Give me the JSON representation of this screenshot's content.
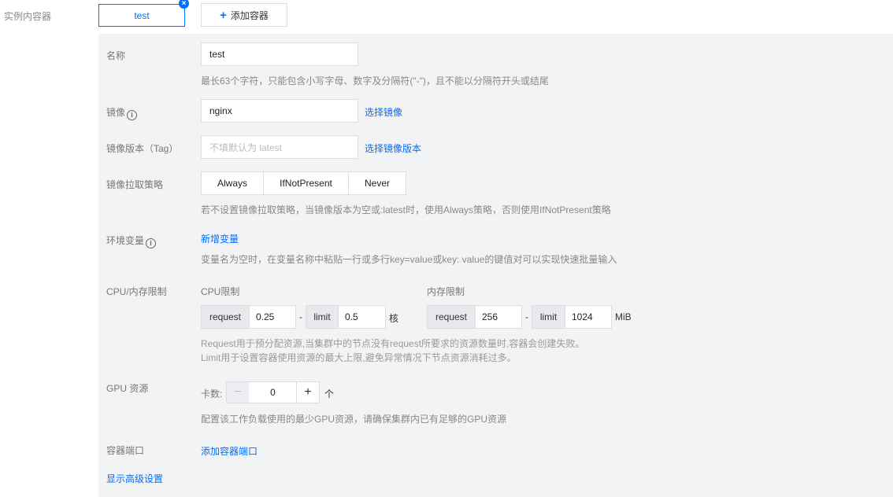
{
  "sidebar": {
    "label": "实例内容器"
  },
  "tabs": {
    "current": "test",
    "close_icon": "×",
    "add_container_label": "添加容器",
    "add_icon": "+"
  },
  "form": {
    "name": {
      "label": "名称",
      "value": "test",
      "hint": "最长63个字符，只能包含小写字母、数字及分隔符(\"-\")，且不能以分隔符开头或结尾"
    },
    "image": {
      "label": "镜像",
      "info_icon": "i",
      "value": "nginx",
      "select_link": "选择镜像"
    },
    "image_tag": {
      "label": "镜像版本（Tag）",
      "placeholder": "不填默认为 latest",
      "select_link": "选择镜像版本"
    },
    "pull_policy": {
      "label": "镜像拉取策略",
      "options": [
        "Always",
        "IfNotPresent",
        "Never"
      ],
      "hint": "若不设置镜像拉取策略，当镜像版本为空或:latest时，使用Always策略，否则使用IfNotPresent策略"
    },
    "env": {
      "label": "环境变量",
      "info_icon": "i",
      "add_link": "新增变量",
      "hint": "变量名为空时，在变量名称中粘贴一行或多行key=value或key: value的键值对可以实现快速批量输入"
    },
    "resources": {
      "label": "CPU/内存限制",
      "cpu": {
        "title": "CPU限制",
        "request_label": "request",
        "request_value": "0.25",
        "separator": "-",
        "limit_label": "limit",
        "limit_value": "0.5",
        "unit": "核"
      },
      "memory": {
        "title": "内存限制",
        "request_label": "request",
        "request_value": "256",
        "separator": "-",
        "limit_label": "limit",
        "limit_value": "1024",
        "unit": "MiB"
      },
      "hint_line1": "Request用于预分配资源,当集群中的节点没有request所要求的资源数量时,容器会创建失败。",
      "hint_line2": "Limit用于设置容器使用资源的最大上限,避免异常情况下节点资源消耗过多。"
    },
    "gpu": {
      "label": "GPU 资源",
      "count_label": "卡数:",
      "minus": "−",
      "value": "0",
      "plus": "+",
      "unit": "个",
      "hint": "配置该工作负载使用的最少GPU资源，请确保集群内已有足够的GPU资源"
    },
    "ports": {
      "label": "容器端口",
      "add_link": "添加容器端口"
    },
    "advanced_link": "显示高级设置"
  },
  "colors": {
    "accent": "#006eff",
    "panel_bg": "#f2f3f5",
    "addon_bg": "#e8e9ec"
  }
}
